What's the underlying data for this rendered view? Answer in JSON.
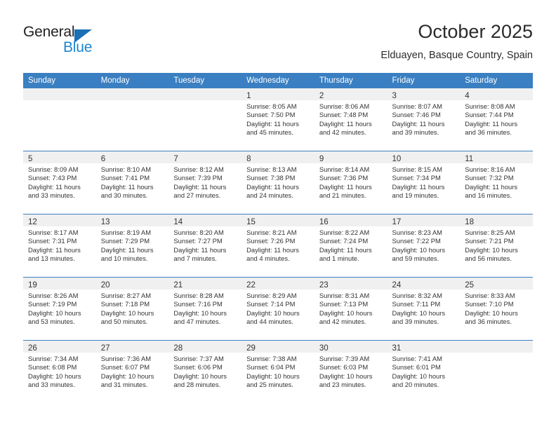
{
  "brand": {
    "word_one": "General",
    "word_two": "Blue",
    "triangle_icon": "triangle-logo-icon",
    "accent_blue": "#1f85d0",
    "triangle_color": "#1a6fb5"
  },
  "header": {
    "title": "October 2025",
    "subtitle": "Elduayen, Basque Country, Spain"
  },
  "calendar": {
    "header_bg": "#3a7fc1",
    "daystrip_bg": "#f0f0f0",
    "weekday_headers": [
      "Sunday",
      "Monday",
      "Tuesday",
      "Wednesday",
      "Thursday",
      "Friday",
      "Saturday"
    ],
    "weeks": [
      [
        {
          "day": "",
          "sunrise": "",
          "sunset": "",
          "daylight": "",
          "empty": true
        },
        {
          "day": "",
          "sunrise": "",
          "sunset": "",
          "daylight": "",
          "empty": true
        },
        {
          "day": "",
          "sunrise": "",
          "sunset": "",
          "daylight": "",
          "empty": true
        },
        {
          "day": "1",
          "sunrise": "Sunrise: 8:05 AM",
          "sunset": "Sunset: 7:50 PM",
          "daylight": "Daylight: 11 hours and 45 minutes."
        },
        {
          "day": "2",
          "sunrise": "Sunrise: 8:06 AM",
          "sunset": "Sunset: 7:48 PM",
          "daylight": "Daylight: 11 hours and 42 minutes."
        },
        {
          "day": "3",
          "sunrise": "Sunrise: 8:07 AM",
          "sunset": "Sunset: 7:46 PM",
          "daylight": "Daylight: 11 hours and 39 minutes."
        },
        {
          "day": "4",
          "sunrise": "Sunrise: 8:08 AM",
          "sunset": "Sunset: 7:44 PM",
          "daylight": "Daylight: 11 hours and 36 minutes."
        }
      ],
      [
        {
          "day": "5",
          "sunrise": "Sunrise: 8:09 AM",
          "sunset": "Sunset: 7:43 PM",
          "daylight": "Daylight: 11 hours and 33 minutes."
        },
        {
          "day": "6",
          "sunrise": "Sunrise: 8:10 AM",
          "sunset": "Sunset: 7:41 PM",
          "daylight": "Daylight: 11 hours and 30 minutes."
        },
        {
          "day": "7",
          "sunrise": "Sunrise: 8:12 AM",
          "sunset": "Sunset: 7:39 PM",
          "daylight": "Daylight: 11 hours and 27 minutes."
        },
        {
          "day": "8",
          "sunrise": "Sunrise: 8:13 AM",
          "sunset": "Sunset: 7:38 PM",
          "daylight": "Daylight: 11 hours and 24 minutes."
        },
        {
          "day": "9",
          "sunrise": "Sunrise: 8:14 AM",
          "sunset": "Sunset: 7:36 PM",
          "daylight": "Daylight: 11 hours and 21 minutes."
        },
        {
          "day": "10",
          "sunrise": "Sunrise: 8:15 AM",
          "sunset": "Sunset: 7:34 PM",
          "daylight": "Daylight: 11 hours and 19 minutes."
        },
        {
          "day": "11",
          "sunrise": "Sunrise: 8:16 AM",
          "sunset": "Sunset: 7:32 PM",
          "daylight": "Daylight: 11 hours and 16 minutes."
        }
      ],
      [
        {
          "day": "12",
          "sunrise": "Sunrise: 8:17 AM",
          "sunset": "Sunset: 7:31 PM",
          "daylight": "Daylight: 11 hours and 13 minutes."
        },
        {
          "day": "13",
          "sunrise": "Sunrise: 8:19 AM",
          "sunset": "Sunset: 7:29 PM",
          "daylight": "Daylight: 11 hours and 10 minutes."
        },
        {
          "day": "14",
          "sunrise": "Sunrise: 8:20 AM",
          "sunset": "Sunset: 7:27 PM",
          "daylight": "Daylight: 11 hours and 7 minutes."
        },
        {
          "day": "15",
          "sunrise": "Sunrise: 8:21 AM",
          "sunset": "Sunset: 7:26 PM",
          "daylight": "Daylight: 11 hours and 4 minutes."
        },
        {
          "day": "16",
          "sunrise": "Sunrise: 8:22 AM",
          "sunset": "Sunset: 7:24 PM",
          "daylight": "Daylight: 11 hours and 1 minute."
        },
        {
          "day": "17",
          "sunrise": "Sunrise: 8:23 AM",
          "sunset": "Sunset: 7:22 PM",
          "daylight": "Daylight: 10 hours and 59 minutes."
        },
        {
          "day": "18",
          "sunrise": "Sunrise: 8:25 AM",
          "sunset": "Sunset: 7:21 PM",
          "daylight": "Daylight: 10 hours and 56 minutes."
        }
      ],
      [
        {
          "day": "19",
          "sunrise": "Sunrise: 8:26 AM",
          "sunset": "Sunset: 7:19 PM",
          "daylight": "Daylight: 10 hours and 53 minutes."
        },
        {
          "day": "20",
          "sunrise": "Sunrise: 8:27 AM",
          "sunset": "Sunset: 7:18 PM",
          "daylight": "Daylight: 10 hours and 50 minutes."
        },
        {
          "day": "21",
          "sunrise": "Sunrise: 8:28 AM",
          "sunset": "Sunset: 7:16 PM",
          "daylight": "Daylight: 10 hours and 47 minutes."
        },
        {
          "day": "22",
          "sunrise": "Sunrise: 8:29 AM",
          "sunset": "Sunset: 7:14 PM",
          "daylight": "Daylight: 10 hours and 44 minutes."
        },
        {
          "day": "23",
          "sunrise": "Sunrise: 8:31 AM",
          "sunset": "Sunset: 7:13 PM",
          "daylight": "Daylight: 10 hours and 42 minutes."
        },
        {
          "day": "24",
          "sunrise": "Sunrise: 8:32 AM",
          "sunset": "Sunset: 7:11 PM",
          "daylight": "Daylight: 10 hours and 39 minutes."
        },
        {
          "day": "25",
          "sunrise": "Sunrise: 8:33 AM",
          "sunset": "Sunset: 7:10 PM",
          "daylight": "Daylight: 10 hours and 36 minutes."
        }
      ],
      [
        {
          "day": "26",
          "sunrise": "Sunrise: 7:34 AM",
          "sunset": "Sunset: 6:08 PM",
          "daylight": "Daylight: 10 hours and 33 minutes."
        },
        {
          "day": "27",
          "sunrise": "Sunrise: 7:36 AM",
          "sunset": "Sunset: 6:07 PM",
          "daylight": "Daylight: 10 hours and 31 minutes."
        },
        {
          "day": "28",
          "sunrise": "Sunrise: 7:37 AM",
          "sunset": "Sunset: 6:06 PM",
          "daylight": "Daylight: 10 hours and 28 minutes."
        },
        {
          "day": "29",
          "sunrise": "Sunrise: 7:38 AM",
          "sunset": "Sunset: 6:04 PM",
          "daylight": "Daylight: 10 hours and 25 minutes."
        },
        {
          "day": "30",
          "sunrise": "Sunrise: 7:39 AM",
          "sunset": "Sunset: 6:03 PM",
          "daylight": "Daylight: 10 hours and 23 minutes."
        },
        {
          "day": "31",
          "sunrise": "Sunrise: 7:41 AM",
          "sunset": "Sunset: 6:01 PM",
          "daylight": "Daylight: 10 hours and 20 minutes."
        },
        {
          "day": "",
          "sunrise": "",
          "sunset": "",
          "daylight": "",
          "empty": true
        }
      ]
    ]
  }
}
